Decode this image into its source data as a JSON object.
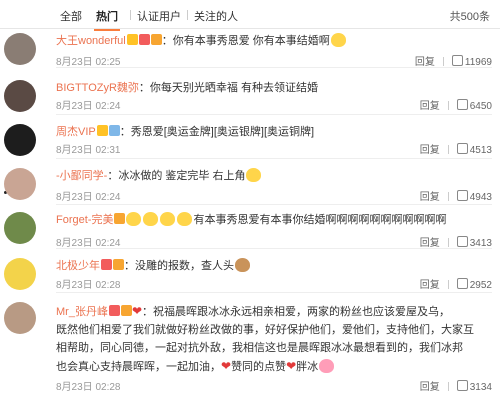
{
  "tabs": {
    "all": "全部",
    "hot": "热门",
    "verified": "认证用户",
    "following": "关注的人"
  },
  "total_count": "共500条",
  "comments": [
    {
      "user": "大王wonderful",
      "text": "：你有本事秀恩爱 你有本事结婚啊",
      "date": "8月23日 02:25",
      "reply": "回复",
      "likes": "11969"
    },
    {
      "user": "BIGTTOZyR魏弥",
      "text": "：你每天别光晒幸福 有种去领证结婚",
      "date": "8月23日 02:24",
      "reply": "回复",
      "likes": "6450"
    },
    {
      "user": "周杰VIP",
      "text": "：秀恩爱[奥运金牌][奥运银牌][奥运铜牌]",
      "date": "8月23日 02:31",
      "reply": "回复",
      "likes": "4513"
    },
    {
      "user": "-小鄙同学-",
      "text": "：冰冰做的 鉴定完毕 右上角",
      "date": "8月23日 02:24",
      "reply": "回复",
      "likes": "4943"
    },
    {
      "user": "Forget-完美",
      "text": "有本事秀恩爱有本事你结婚啊啊啊啊啊啊啊啊啊啊啊",
      "date": "8月23日 02:24",
      "reply": "回复",
      "likes": "3413"
    },
    {
      "user": "北极少年",
      "text": "：没雕的报数，查人头",
      "date": "8月23日 02:28",
      "reply": "回复",
      "likes": "2952"
    },
    {
      "user": "Mr_张丹峰",
      "text1": "：祝福晨晖跟冰冰永远相亲相爱，两家的粉丝也应该爱屋及乌，",
      "text2": "既然他们相爱了我们就做好粉丝改做的事，好好保护他们，爱他们，支持他们，大家互",
      "text3": "相帮助，同心同德，一起对抗外敌，我相信这也是晨晖跟冰冰最想看到的，我们冰邦",
      "text4": "也会真心支持晨晖晖，一起加油，",
      "text5": "赞同的点赞",
      "text6": "胖冰",
      "date": "8月23日 02:28",
      "reply": "回复",
      "likes": "3134"
    }
  ],
  "colors": {
    "accent": "#fa7d3c",
    "username": "#eb7350"
  },
  "icons": {
    "thumb": "thumb-up-icon",
    "emoji": "emoji-icon"
  }
}
